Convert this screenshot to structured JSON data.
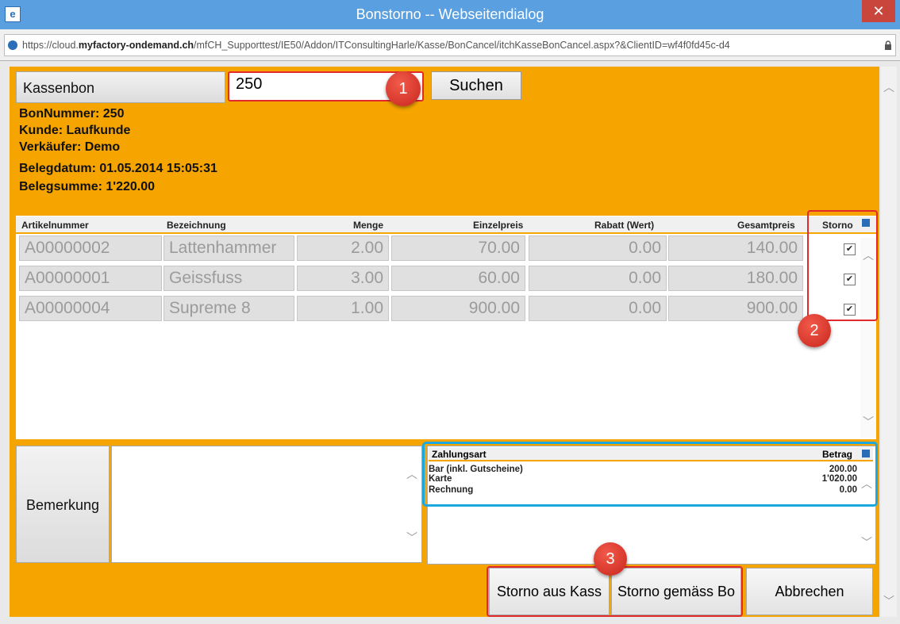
{
  "window": {
    "title": "Bonstorno -- Webseitendialog",
    "url_prefix": "https://cloud.",
    "url_domain": "myfactory-ondemand.ch",
    "url_path": "/mfCH_Supporttest/IE50/Addon/ITConsultingHarle/Kasse/BonCancel/itchKasseBonCancel.aspx?&ClientID=wf4f0fd45c-d4"
  },
  "search": {
    "label": "Kassenbon",
    "value": "250",
    "button": "Suchen"
  },
  "info": {
    "bon": "BonNummer: 250",
    "kunde": "Kunde: Laufkunde",
    "verkaeufer": "Verkäufer: Demo",
    "datum": "Belegdatum: 01.05.2014 15:05:31",
    "summe": "Belegsumme: 1'220.00"
  },
  "grid": {
    "columns": [
      "Artikelnummer",
      "Bezeichnung",
      "Menge",
      "Einzelpreis",
      "Rabatt (Wert)",
      "Gesamtpreis",
      "Storno"
    ],
    "rows": [
      {
        "nr": "A00000002",
        "bez": "Lattenhammer",
        "menge": "2.00",
        "ep": "70.00",
        "rabatt": "0.00",
        "gp": "140.00",
        "storno": true
      },
      {
        "nr": "A00000001",
        "bez": "Geissfuss",
        "menge": "3.00",
        "ep": "60.00",
        "rabatt": "0.00",
        "gp": "180.00",
        "storno": true
      },
      {
        "nr": "A00000004",
        "bez": "Supreme 8",
        "menge": "1.00",
        "ep": "900.00",
        "rabatt": "0.00",
        "gp": "900.00",
        "storno": true
      }
    ]
  },
  "bemerkung": {
    "label": "Bemerkung",
    "value": ""
  },
  "payments": {
    "col_type": "Zahlungsart",
    "col_amount": "Betrag",
    "rows": [
      {
        "type": "Bar (inkl. Gutscheine)",
        "amount": "200.00"
      },
      {
        "type": "Karte",
        "amount": "1'020.00"
      },
      {
        "type": "Rechnung",
        "amount": "0.00"
      }
    ]
  },
  "actions": {
    "storno_kasse": "Storno aus Kass",
    "storno_bon": "Storno gemäss Bo",
    "cancel": "Abbrechen"
  },
  "callouts": [
    "1",
    "2",
    "3"
  ],
  "colors": {
    "accent": "#f5a400",
    "callout_red": "#e32a2a",
    "callout_blue": "#1ca8df"
  }
}
